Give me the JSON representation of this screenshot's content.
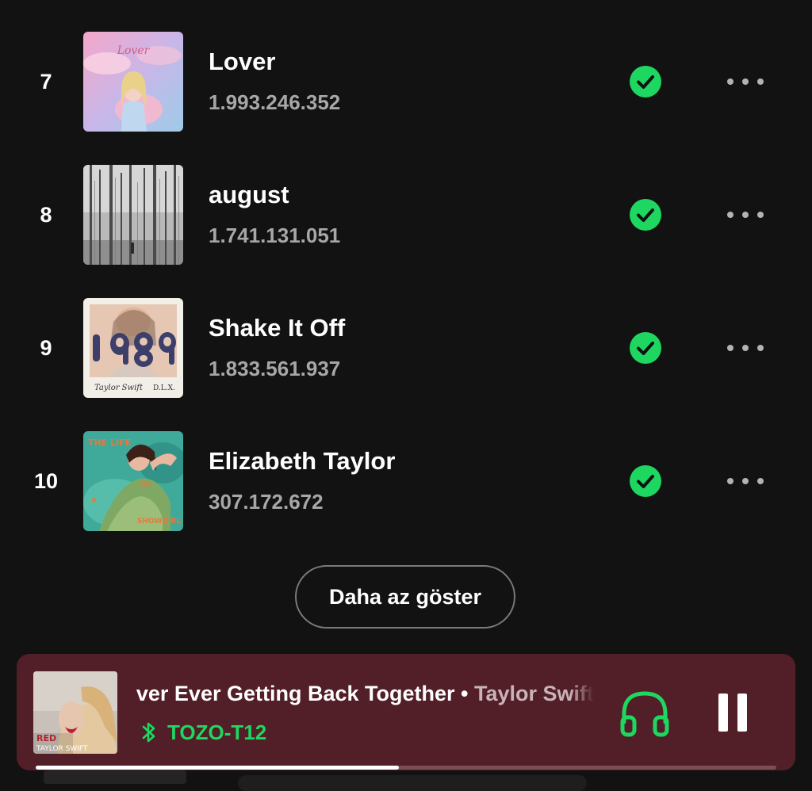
{
  "tracks": [
    {
      "number": "7",
      "title": "Lover",
      "plays": "1.993.246.352",
      "album_art": "lover-album-cover"
    },
    {
      "number": "8",
      "title": "august",
      "plays": "1.741.131.051",
      "album_art": "folklore-album-cover"
    },
    {
      "number": "9",
      "title": "Shake It Off",
      "plays": "1.833.561.937",
      "album_art": "1989-album-cover"
    },
    {
      "number": "10",
      "title": "Elizabeth Taylor",
      "plays": "307.172.672",
      "album_art": "showgirl-album-cover"
    }
  ],
  "show_less_label": "Daha az göster",
  "now_playing": {
    "song": "Never Ever Getting Back Together",
    "separator": " • ",
    "artist": "Taylor Swift",
    "device_icon": "bluetooth-icon",
    "device": "TOZO-T12",
    "output_icon": "headphones-icon",
    "control_icon": "pause-icon",
    "progress": 0.49
  },
  "colors": {
    "background": "#121212",
    "accent_green": "#1ed760",
    "player_background": "#521e27",
    "secondary_text": "#a7a7a7"
  }
}
